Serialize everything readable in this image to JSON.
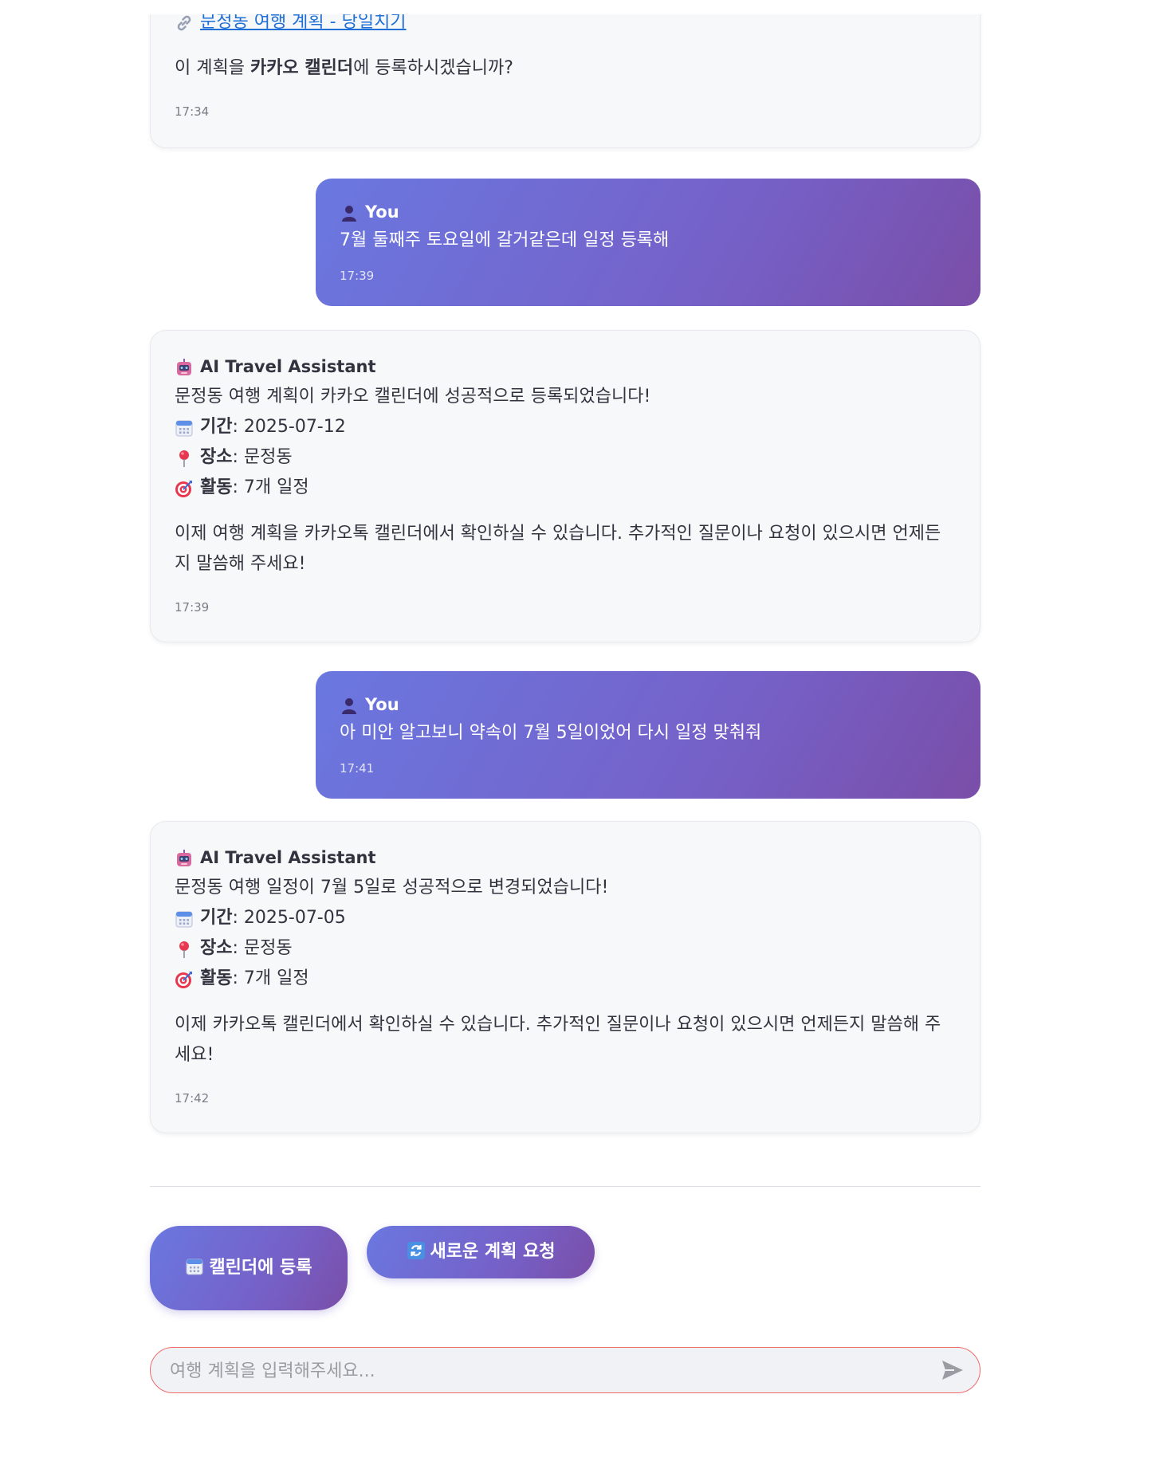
{
  "messages": [
    {
      "link_text": "문정동 여행 계획 - 당일치기",
      "question_pre": "이 계획을 ",
      "question_bold": "카카오 캘린더",
      "question_post": "에 등록하시겠습니까?",
      "time": "17:34"
    },
    {
      "sender": "You",
      "text": "7월 둘째주 토요일에 갈거같은데 일정 등록해",
      "time": "17:39"
    },
    {
      "sender": "AI Travel Assistant",
      "headline": "문정동 여행 계획이 카카오 캘린더에 성공적으로 등록되었습니다!",
      "period_label": "기간",
      "period_value": ": 2025-07-12",
      "place_label": "장소",
      "place_value": ": 문정동",
      "activity_label": "활동",
      "activity_value": ": 7개 일정",
      "closing": "이제 여행 계획을 카카오톡 캘린더에서 확인하실 수 있습니다. 추가적인 질문이나 요청이 있으시면 언제든지 말씀해 주세요!",
      "time": "17:39"
    },
    {
      "sender": "You",
      "text": "아 미안 알고보니 약속이 7월 5일이었어 다시 일정 맞춰줘",
      "time": "17:41"
    },
    {
      "sender": "AI Travel Assistant",
      "headline": "문정동 여행 일정이 7월 5일로 성공적으로 변경되었습니다!",
      "period_label": "기간",
      "period_value": ": 2025-07-05",
      "place_label": "장소",
      "place_value": ": 문정동",
      "activity_label": "활동",
      "activity_value": ": 7개 일정",
      "closing": "이제 카카오톡 캘린더에서 확인하실 수 있습니다. 추가적인 질문이나 요청이 있으시면 언제든지 말씀해 주세요!",
      "time": "17:42"
    }
  ],
  "actions": {
    "calendar_label": "캘린더에 등록",
    "new_plan_label": "새로운 계획 요청"
  },
  "chat_input": {
    "placeholder": "여행 계획을 입력해주세요...",
    "value": ""
  },
  "icons": {
    "link": "link-icon",
    "user": "person-silhouette-icon",
    "assistant": "robot-icon",
    "period": "calendar-icon",
    "place": "pushpin-icon",
    "activity": "target-icon",
    "new_plan": "refresh-icon",
    "send": "send-icon"
  },
  "colors": {
    "accent_start": "#6a78e0",
    "accent_end": "#7a4ea8",
    "input_border": "#f06a6a",
    "link": "#1f6fd6"
  }
}
